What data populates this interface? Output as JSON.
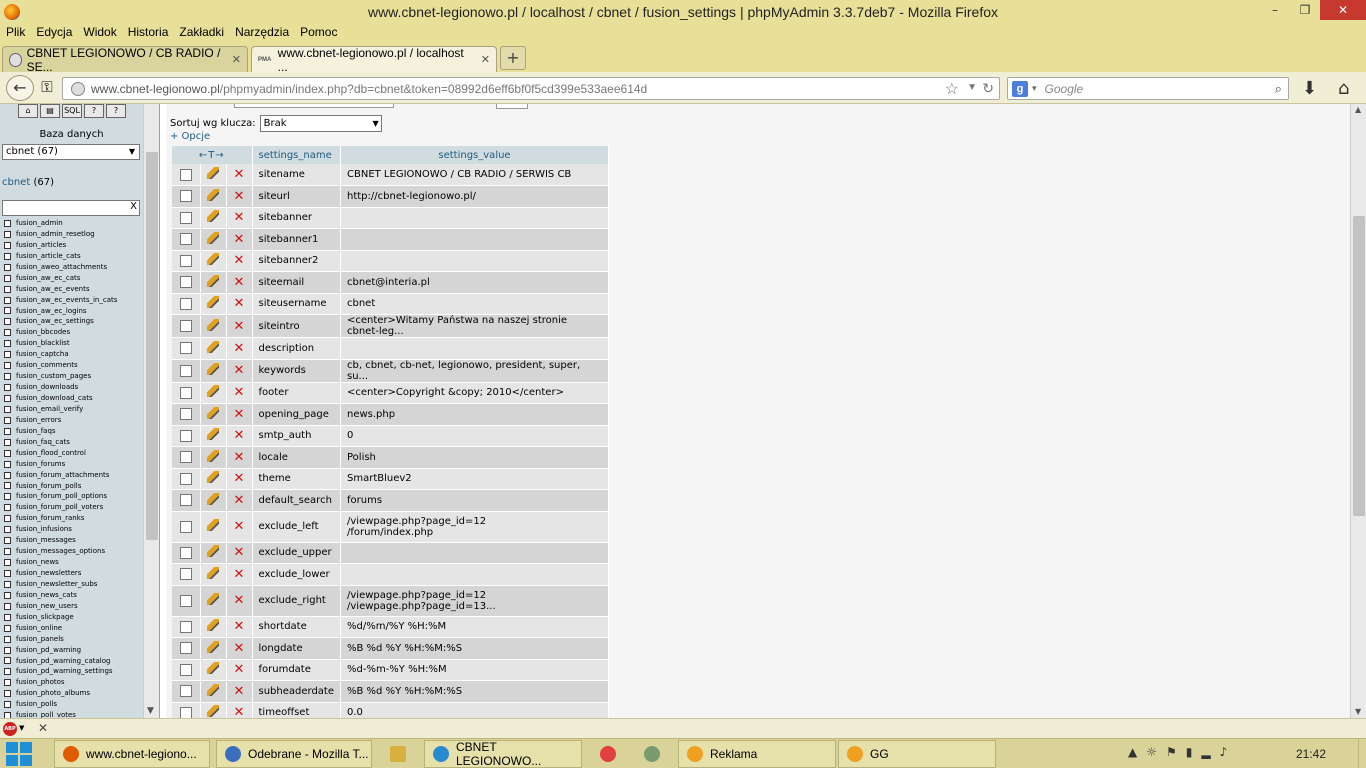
{
  "window": {
    "title": "www.cbnet-legionowo.pl / localhost / cbnet / fusion_settings | phpMyAdmin 3.3.7deb7 - Mozilla Firefox",
    "buttons": {
      "minimize": "–",
      "maximize": "❐",
      "close": "✕"
    }
  },
  "menu": [
    "Plik",
    "Edycja",
    "Widok",
    "Historia",
    "Zakładki",
    "Narzędzia",
    "Pomoc"
  ],
  "tabs": [
    {
      "label": "CBNET LEGIONOWO / CB RADIO / SE...",
      "active": false
    },
    {
      "label": "www.cbnet-legionowo.pl / localhost ...",
      "active": true
    }
  ],
  "tab_close": "✕",
  "new_tab": "+",
  "nav": {
    "url_host": "www.cbnet-legionowo.pl",
    "url_rest": "/phpmyadmin/index.php?db=cbnet&token=08992d6eff6bf0f5cd399e533aee614d",
    "search_placeholder": "Google"
  },
  "sidebar": {
    "db_label": "Baza danych",
    "db_select": "cbnet (67)",
    "db_link": "cbnet",
    "db_count": " (67)",
    "filter_clear": "X",
    "tables": [
      "fusion_admin",
      "fusion_admin_resetlog",
      "fusion_articles",
      "fusion_article_cats",
      "fusion_aweo_attachments",
      "fusion_aw_ec_cats",
      "fusion_aw_ec_events",
      "fusion_aw_ec_events_in_cats",
      "fusion_aw_ec_logins",
      "fusion_aw_ec_settings",
      "fusion_bbcodes",
      "fusion_blacklist",
      "fusion_captcha",
      "fusion_comments",
      "fusion_custom_pages",
      "fusion_downloads",
      "fusion_download_cats",
      "fusion_email_verify",
      "fusion_errors",
      "fusion_faqs",
      "fusion_faq_cats",
      "fusion_flood_control",
      "fusion_forums",
      "fusion_forum_attachments",
      "fusion_forum_polls",
      "fusion_forum_poll_options",
      "fusion_forum_poll_voters",
      "fusion_forum_ranks",
      "fusion_infusions",
      "fusion_messages",
      "fusion_messages_options",
      "fusion_news",
      "fusion_newsletters",
      "fusion_newsletter_subs",
      "fusion_news_cats",
      "fusion_new_users",
      "fusion_slickpage",
      "fusion_online",
      "fusion_panels",
      "fusion_pd_warning",
      "fusion_pd_warning_catalog",
      "fusion_pd_warning_settings",
      "fusion_photos",
      "fusion_photo_albums",
      "fusion_polls",
      "fusion_poll_votes"
    ]
  },
  "main": {
    "sort_label": "Sortuj wg klucza:",
    "sort_value": "Brak",
    "options_link": "+ Opcje",
    "header_arrows": "←T→",
    "columns": [
      "settings_name",
      "settings_value"
    ],
    "rows": [
      {
        "name": "sitename",
        "value": "CBNET LEGIONOWO / CB RADIO / SERWIS CB"
      },
      {
        "name": "siteurl",
        "value": "http://cbnet-legionowo.pl/"
      },
      {
        "name": "sitebanner",
        "value": ""
      },
      {
        "name": "sitebanner1",
        "value": ""
      },
      {
        "name": "sitebanner2",
        "value": ""
      },
      {
        "name": "siteemail",
        "value": "cbnet@interia.pl"
      },
      {
        "name": "siteusername",
        "value": "cbnet"
      },
      {
        "name": "siteintro",
        "value": "<center>Witamy Państwa na naszej stronie cbnet-leg..."
      },
      {
        "name": "description",
        "value": ""
      },
      {
        "name": "keywords",
        "value": "cb, cbnet, cb-net, legionowo, president, super, su..."
      },
      {
        "name": "footer",
        "value": "<center>Copyright &copy; 2010</center>"
      },
      {
        "name": "opening_page",
        "value": "news.php"
      },
      {
        "name": "smtp_auth",
        "value": "0"
      },
      {
        "name": "locale",
        "value": "Polish"
      },
      {
        "name": "theme",
        "value": "SmartBluev2"
      },
      {
        "name": "default_search",
        "value": "forums"
      },
      {
        "name": "exclude_left",
        "value": "/viewpage.php?page_id=12",
        "value2": "/forum/index.php"
      },
      {
        "name": "exclude_upper",
        "value": ""
      },
      {
        "name": "exclude_lower",
        "value": ""
      },
      {
        "name": "exclude_right",
        "value": "/viewpage.php?page_id=12",
        "value2": "/viewpage.php?page_id=13..."
      },
      {
        "name": "shortdate",
        "value": "%d/%m/%Y %H:%M"
      },
      {
        "name": "longdate",
        "value": "%B %d %Y %H:%M:%S"
      },
      {
        "name": "forumdate",
        "value": "%d-%m-%Y %H:%M"
      },
      {
        "name": "subheaderdate",
        "value": "%B %d %Y %H:%M:%S"
      },
      {
        "name": "timeoffset",
        "value": "0.0"
      }
    ]
  },
  "addon": {
    "abp": "ABP"
  },
  "taskbar": {
    "items": [
      {
        "label": "www.cbnet-legiono...",
        "color": "#e05a00"
      },
      {
        "label": "Odebrane - Mozilla T...",
        "color": "#3a6fc0"
      },
      {
        "label": "",
        "color": "#d9b040"
      },
      {
        "label": "CBNET LEGIONOWO...",
        "color": "#2a8ad0"
      },
      {
        "label": "",
        "color": "#e04040"
      },
      {
        "label": "",
        "color": "#7a9a70"
      },
      {
        "label": "Reklama",
        "color": "#f0a020"
      },
      {
        "label": "GG",
        "color": "#f0a020"
      }
    ],
    "clock": "21:42"
  }
}
